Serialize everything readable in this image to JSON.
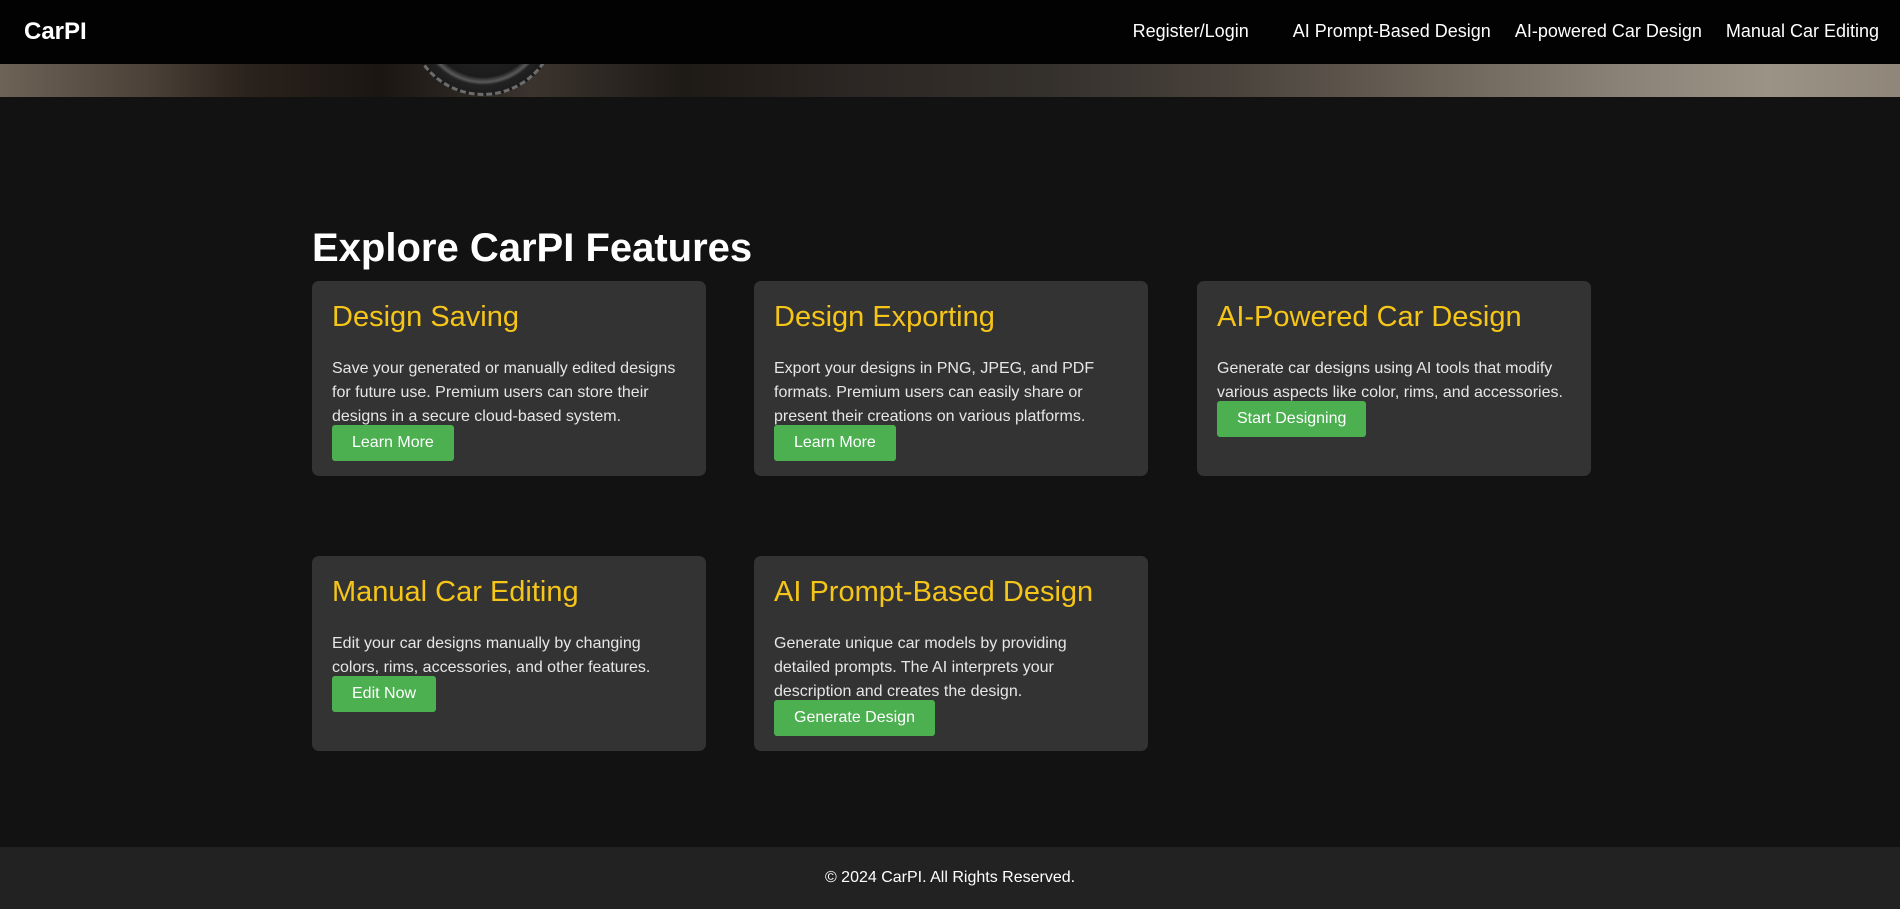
{
  "navbar": {
    "brand": "CarPI",
    "links": [
      {
        "label": "Register/Login"
      },
      {
        "label": "AI Prompt-Based Design"
      },
      {
        "label": "AI-powered Car Design"
      },
      {
        "label": "Manual Car Editing"
      }
    ]
  },
  "features": {
    "title": "Explore CarPI Features",
    "cards": [
      {
        "title": "Design Saving",
        "description": "Save your generated or manually edited designs for future use. Premium users can store their designs in a secure cloud-based system.",
        "button": "Learn More"
      },
      {
        "title": "Design Exporting",
        "description": "Export your designs in PNG, JPEG, and PDF formats. Premium users can easily share or present their creations on various platforms.",
        "button": "Learn More"
      },
      {
        "title": "AI-Powered Car Design",
        "description": "Generate car designs using AI tools that modify various aspects like color, rims, and accessories.",
        "button": "Start Designing"
      },
      {
        "title": "Manual Car Editing",
        "description": "Edit your car designs manually by changing colors, rims, accessories, and other features.",
        "button": "Edit Now"
      },
      {
        "title": "AI Prompt-Based Design",
        "description": "Generate unique car models by providing detailed prompts. The AI interprets your description and creates the design.",
        "button": "Generate Design"
      }
    ]
  },
  "footer": {
    "text": "© 2024 CarPI. All Rights Reserved."
  },
  "colors": {
    "accent_title": "#f5c518",
    "button": "#4caf50",
    "card_bg": "#333333",
    "page_bg": "#121212"
  }
}
